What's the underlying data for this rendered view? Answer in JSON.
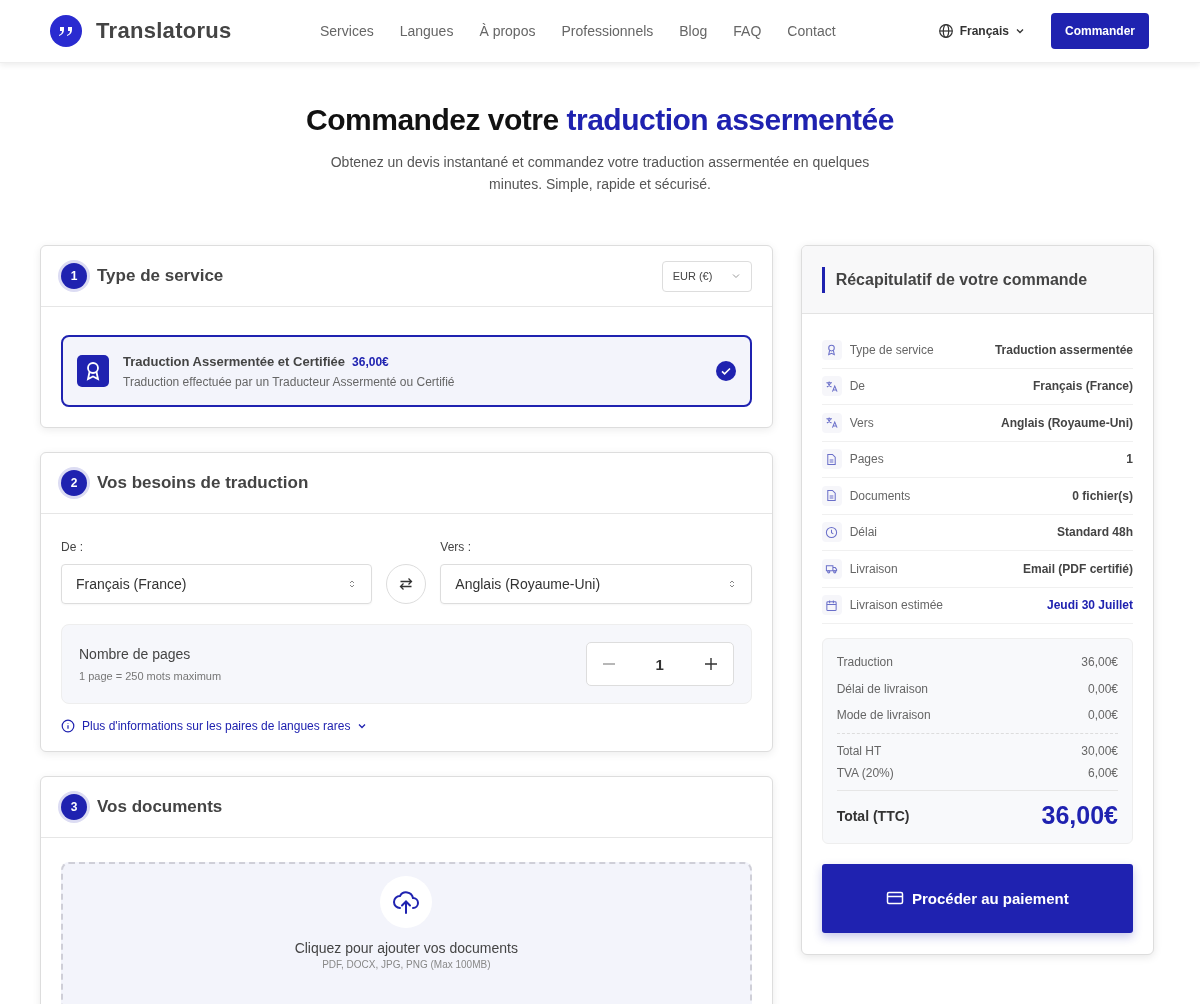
{
  "header": {
    "logo_text": "Translatorus",
    "nav": [
      "Services",
      "Langues",
      "À propos",
      "Professionnels",
      "Blog",
      "FAQ",
      "Contact"
    ],
    "language": "Français",
    "cta": "Commander"
  },
  "hero": {
    "title_lead": "Commandez votre",
    "title_highlight": "traduction assermentée",
    "subtitle": "Obtenez un devis instantané et commandez votre traduction assermentée en quelques minutes. Simple, rapide et sécurisé."
  },
  "steps": [
    {
      "kind": "service",
      "number": "1",
      "title": "Type de service",
      "currency": "EUR (€)",
      "options": [
        {
          "title": "Traduction Assermentée et Certifiée",
          "price": "36,00€",
          "description": "Traduction effectuée par un Traducteur Assermenté ou Certifié",
          "selected": true
        }
      ]
    },
    {
      "kind": "languages",
      "number": "2",
      "title": "Vos besoins de traduction",
      "from_label": "De :",
      "from_value": "Français (France)",
      "to_label": "Vers :",
      "to_value": "Anglais (Royaume-Uni)",
      "pages_label": "Nombre de pages",
      "pages_hint": "1 page = 250 mots maximum",
      "pages_value": "1",
      "info_link": "Plus d'informations sur les paires de langues rares"
    },
    {
      "kind": "documents",
      "number": "3",
      "title": "Vos documents",
      "upload_text": "Cliquez pour ajouter vos documents",
      "upload_formats": "PDF, DOCX, JPG, PNG (Max 100MB)"
    }
  ],
  "summary": {
    "title": "Récapitulatif de votre commande",
    "rows": [
      {
        "kind": "service",
        "label": "Type de service",
        "value": "Traduction assermentée",
        "highlight": false
      },
      {
        "kind": "language",
        "label": "De",
        "value": "Français (France)",
        "highlight": false
      },
      {
        "kind": "language",
        "label": "Vers",
        "value": "Anglais (Royaume-Uni)",
        "highlight": false
      },
      {
        "kind": "document",
        "label": "Pages",
        "value": "1",
        "highlight": false
      },
      {
        "kind": "document",
        "label": "Documents",
        "value": "0 fichier(s)",
        "highlight": false
      },
      {
        "kind": "clock",
        "label": "Délai",
        "value": "Standard 48h",
        "highlight": false
      },
      {
        "kind": "delivery",
        "label": "Livraison",
        "value": "Email (PDF certifié)",
        "highlight": false
      },
      {
        "kind": "calendar",
        "label": "Livraison estimée",
        "value": "Jeudi 30 Juillet",
        "highlight": true
      }
    ],
    "costs": [
      {
        "label": "Traduction",
        "value": "36,00€"
      },
      {
        "label": "Délai de livraison",
        "value": "0,00€"
      },
      {
        "label": "Mode de livraison",
        "value": "0,00€"
      }
    ],
    "taxes": [
      {
        "label": "Total HT",
        "value": "30,00€"
      },
      {
        "label": "TVA (20%)",
        "value": "6,00€"
      }
    ],
    "total_label": "Total (TTC)",
    "total_value": "36,00€",
    "pay_button": "Procéder au paiement"
  }
}
